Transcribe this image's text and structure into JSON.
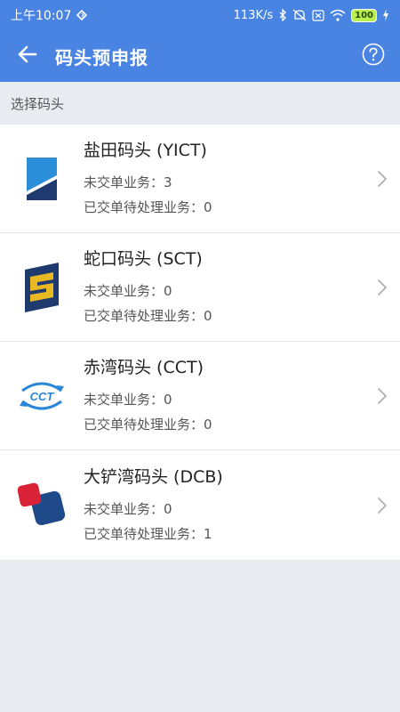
{
  "status_bar": {
    "time": "上午10:07",
    "network_speed": "113K/s",
    "battery": "100",
    "icons": [
      "sync-icon",
      "bluetooth-icon",
      "mute-icon",
      "sim-off-icon",
      "wifi-icon",
      "battery-icon",
      "charging-icon"
    ]
  },
  "app_bar": {
    "title": "码头预申报",
    "back_icon": "back-arrow-icon",
    "help_icon": "help-circle-icon"
  },
  "section": {
    "label": "选择码头"
  },
  "terminals": [
    {
      "name": "盐田码头 (YICT)",
      "pending_line": "未交单业务：3",
      "submitted_line": "已交单待处理业务：0",
      "pending_count": 3,
      "submitted_count": 0,
      "logo": "yict-logo"
    },
    {
      "name": "蛇口码头 (SCT)",
      "pending_line": "未交单业务：0",
      "submitted_line": "已交单待处理业务：0",
      "pending_count": 0,
      "submitted_count": 0,
      "logo": "sct-logo"
    },
    {
      "name": "赤湾码头 (CCT)",
      "pending_line": "未交单业务：0",
      "submitted_line": "已交单待处理业务：0",
      "pending_count": 0,
      "submitted_count": 0,
      "logo": "cct-logo"
    },
    {
      "name": "大铲湾码头 (DCB)",
      "pending_line": "未交单业务：0",
      "submitted_line": "已交单待处理业务：1",
      "pending_count": 0,
      "submitted_count": 1,
      "logo": "dcb-logo"
    }
  ],
  "colors": {
    "primary": "#4a84e2",
    "background": "#e8ecf1",
    "yict_navy": "#1f3a6e",
    "yict_blue": "#2a8fd8",
    "sct_gold": "#e8b923",
    "cct_blue": "#2a86d6",
    "dcb_red": "#d92236",
    "dcb_navy": "#1f4a8a"
  }
}
